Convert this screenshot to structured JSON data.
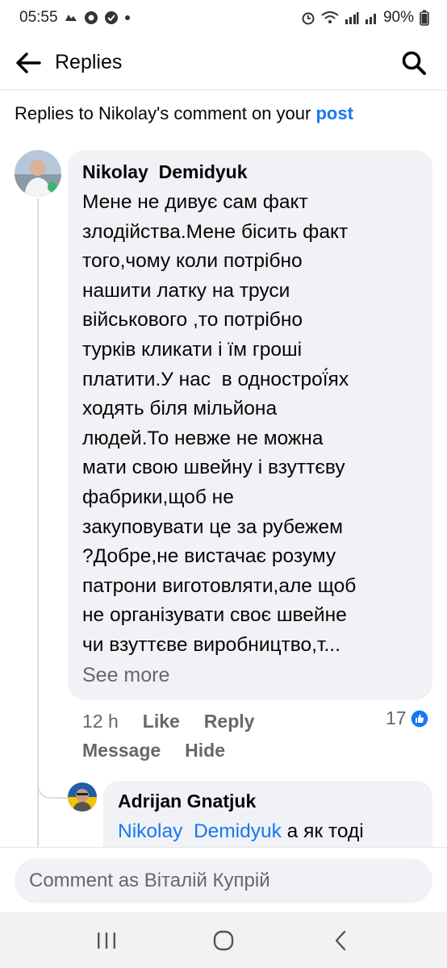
{
  "status_bar": {
    "time": "05:55",
    "battery": "90%"
  },
  "header": {
    "title": "Replies"
  },
  "context": {
    "prefix": "Replies to Nikolay's comment on your ",
    "link": "post"
  },
  "comment": {
    "author": "Nikolay  Demidyuk",
    "lines": [
      "Мене не дивує сам факт",
      "злодійства.Мене бісить факт",
      "того,чому коли потрібно",
      "нашити латку на труси",
      "військового ,то потрібно",
      "турків кликати і їм гроші",
      "платити.У нас  в однострої́ях",
      "ходять біля мільйона",
      "людей.То невже не можна",
      "мати свою швейну і взуттєву",
      "фабрики,щоб не",
      "закуповувати це за рубежем",
      "?Добре,не вистачає розуму",
      "патрони виготовляти,але щоб",
      "не організувати своє швейне",
      "чи взуттєве виробництво,т..."
    ],
    "see_more": "See more",
    "time": "12 h",
    "like": "Like",
    "reply": "Reply",
    "message": "Message",
    "hide": "Hide",
    "reaction_count": "17"
  },
  "reply": {
    "author": "Adrijan Gnatjuk",
    "mention": "Nikolay  Demidyuk",
    "text": " а як тоді"
  },
  "composer": {
    "placeholder": "Comment as Віталій Купрій"
  },
  "colors": {
    "accent": "#1877f2",
    "bubble": "#f0f2f5",
    "secondary_text": "#65676b"
  }
}
